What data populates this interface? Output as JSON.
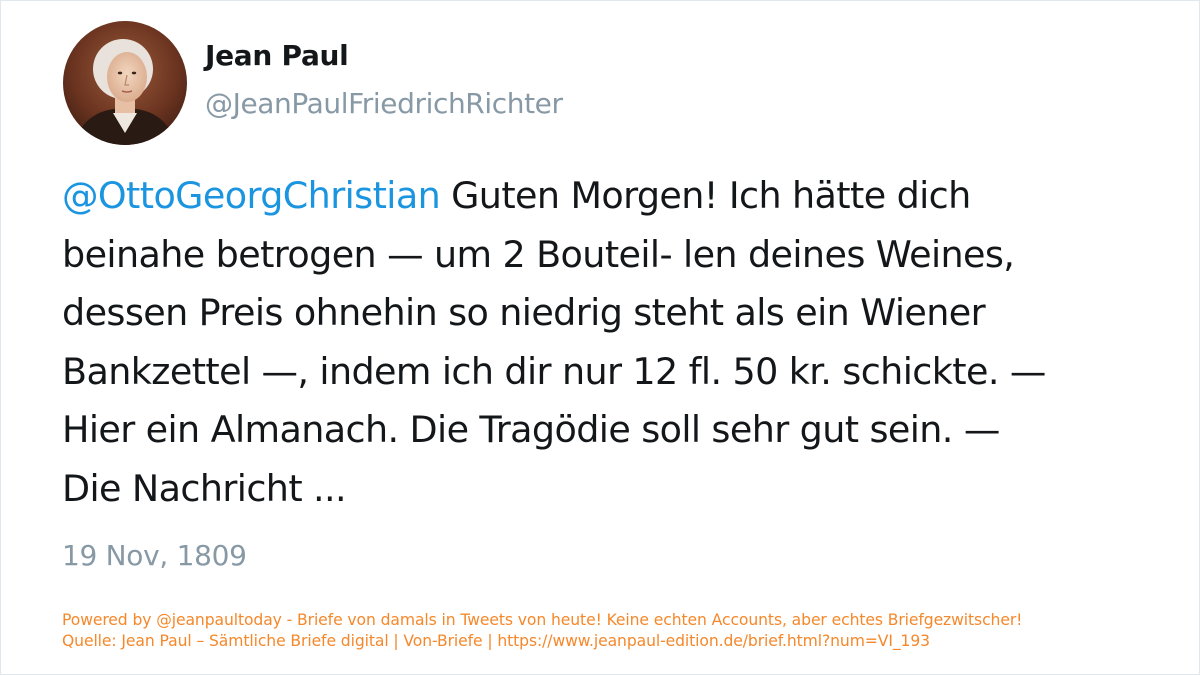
{
  "tweet": {
    "author_name": "Jean Paul",
    "author_handle": "@JeanPaulFriedrichRichter",
    "mention": "@OttoGeorgChristian",
    "text_lines": [
      " Guten Morgen! Ich hätte dich",
      "beinahe betrogen — um 2 Bouteil- len deines Weines,",
      "dessen Preis ohnehin so niedrig steht als ein Wiener",
      "Bankzettel —, indem ich dir nur 12 fl. 50 kr. schickte. —",
      "Hier ein Almanach. Die Tragödie soll sehr gut sein. —",
      "Die Nachricht ..."
    ],
    "date": "19 Nov, 1809"
  },
  "footer": {
    "line1": "Powered by @jeanpaultoday - Briefe von damals in Tweets von heute! Keine echten Accounts, aber echtes Briefgezwitscher!",
    "line2": "Quelle: Jean Paul – Sämtliche Briefe digital | Von-Briefe | https://www.jeanpaul-edition.de/brief.html?num=VI_193"
  },
  "colors": {
    "mention": "#1b95e0",
    "text": "#14171a",
    "muted": "#8899a6",
    "footer": "#f5882b"
  },
  "icons": {
    "avatar": "portrait-avatar"
  }
}
